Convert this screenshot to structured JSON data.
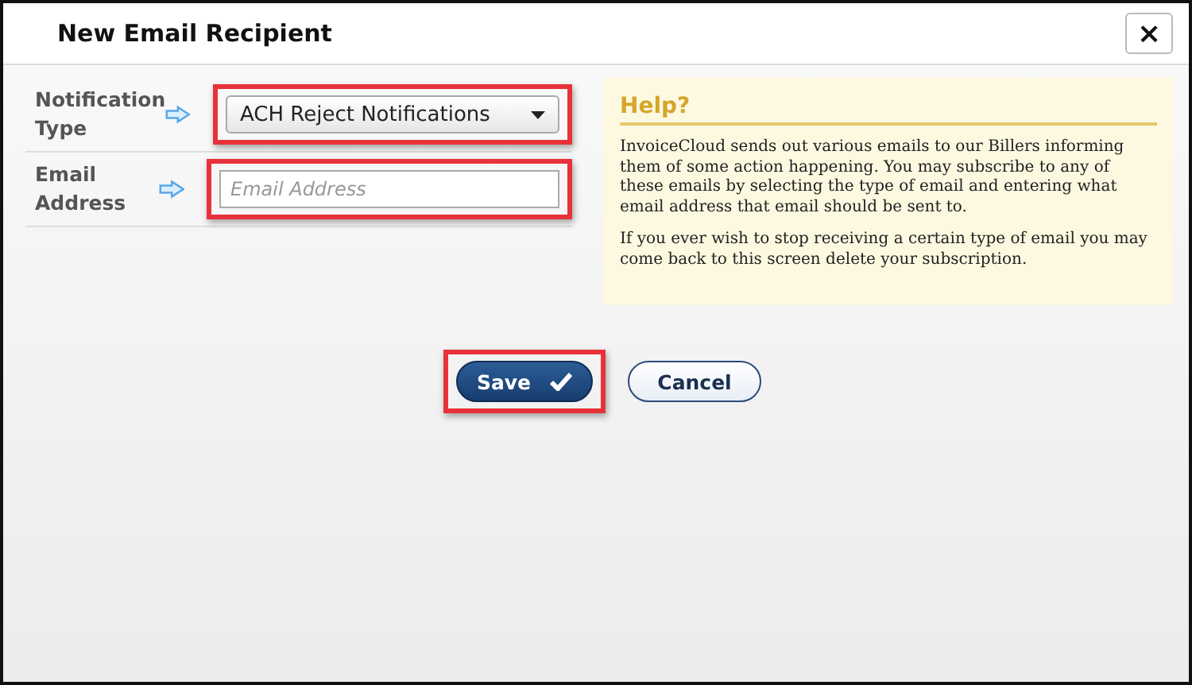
{
  "window": {
    "title": "New Email Recipient",
    "close": "×"
  },
  "fields": [
    {
      "kind": "select",
      "label": "Notification Type",
      "value": "ACH Reject Notifications",
      "highlighted": true
    },
    {
      "kind": "input",
      "label": "Email Address",
      "placeholder": "Email Address",
      "highlighted": true
    }
  ],
  "help": {
    "title": "Help?",
    "paragraphs": [
      "InvoiceCloud sends out various emails to our Billers informing them of some action happening. You may subscribe to any of these emails by selecting the type of email and entering what email address that email should be sent to.",
      "If you ever wish to stop receiving a certain type of email you may come back to this screen delete your subscription."
    ]
  },
  "buttons": [
    {
      "kind": "primary",
      "label": "Save",
      "highlighted": true
    },
    {
      "kind": "secondary",
      "label": "Cancel",
      "highlighted": false
    }
  ]
}
